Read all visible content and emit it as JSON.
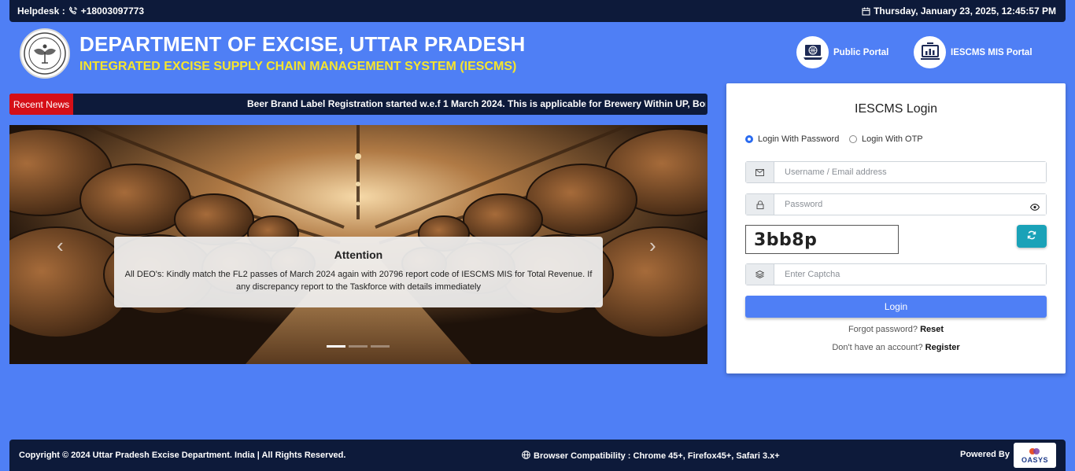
{
  "topbar": {
    "helpdesk_label": "Helpdesk :",
    "helpdesk_phone": "+18003097773",
    "datetime": "Thursday, January 23, 2025, 12:45:57 PM"
  },
  "header": {
    "title": "DEPARTMENT OF EXCISE, UTTAR PRADESH",
    "subtitle": "INTEGRATED EXCISE SUPPLY CHAIN MANAGEMENT SYSTEM (IESCMS)",
    "portals": [
      {
        "label": "Public Portal",
        "icon": "public-portal-icon"
      },
      {
        "label": "IESCMS MIS Portal",
        "icon": "mis-portal-icon"
      }
    ]
  },
  "news": {
    "tag": "Recent News",
    "text": "Beer Brand Label Registration started w.e.f 1 March 2024. This is applicable for Brewery Within UP, Bond (BW"
  },
  "carousel": {
    "caption_title": "Attention",
    "caption_text": "All DEO's: Kindly match the FL2 passes of March 2024 again with 20796 report code of IESCMS MIS for Total Revenue. If any discrepancy report to the Taskforce with details immediately",
    "prev": "‹",
    "next": "›",
    "active_slide": 1,
    "slide_count": 3
  },
  "login": {
    "title": "IESCMS Login",
    "mode_password": "Login With Password",
    "mode_otp": "Login With OTP",
    "selected_mode": "password",
    "username_placeholder": "Username / Email address",
    "password_placeholder": "Password",
    "captcha_text": "3bb8p",
    "captcha_placeholder": "Enter Captcha",
    "login_button": "Login",
    "forgot_text": "Forgot password?",
    "reset_link": "Reset",
    "register_text": "Don't have an account?",
    "register_link": "Register"
  },
  "footer": {
    "copyright": "Copyright © 2024 Uttar Pradesh Excise Department. India | All Rights Reserved.",
    "compat": "Browser Compatibility : Chrome 45+, Firefox45+, Safari 3.x+",
    "powered_by": "Powered By",
    "vendor": "OASYS"
  },
  "colors": {
    "page_bg": "#4f7ff5",
    "bar_bg": "#0d1a3a",
    "subtitle": "#f6e52c",
    "news_tag": "#d50f17",
    "refresh_btn": "#1aa2b8"
  }
}
